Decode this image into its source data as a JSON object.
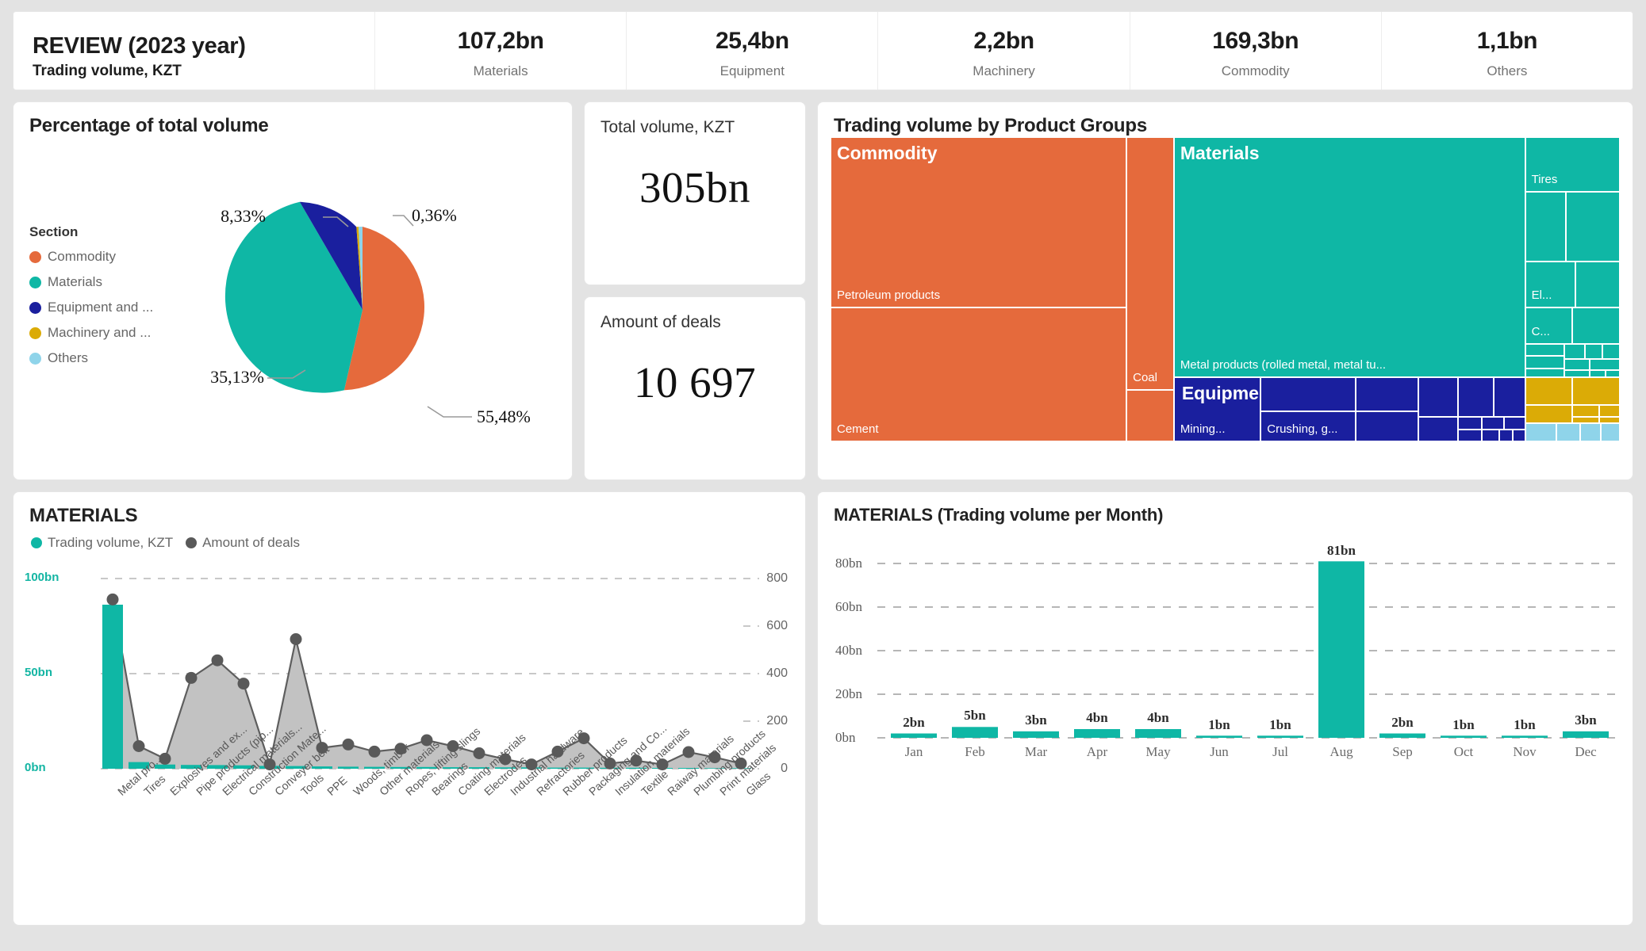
{
  "header": {
    "title": "REVIEW (2023 year)",
    "subtitle": "Trading volume, KZT",
    "kpis": [
      {
        "value": "107,2bn",
        "label": "Materials"
      },
      {
        "value": "25,4bn",
        "label": "Equipment"
      },
      {
        "value": "2,2bn",
        "label": "Machinery"
      },
      {
        "value": "169,3bn",
        "label": "Commodity"
      },
      {
        "value": "1,1bn",
        "label": "Others"
      }
    ]
  },
  "colors": {
    "commodity": "#e56a3c",
    "materials": "#0fb7a5",
    "equipment": "#1a1f9e",
    "machinery": "#dbab06",
    "others": "#8fd4ea",
    "teal_accent": "#14b5a3",
    "gray_series": "#bfbfbf",
    "gray_marker": "#595959",
    "page_bg": "#e3e3e3",
    "card_bg": "#ffffff"
  },
  "pie_card": {
    "title": "Percentage of total volume",
    "legend_heading": "Section",
    "legend": [
      {
        "label": "Commodity",
        "color": "#e56a3c"
      },
      {
        "label": "Materials",
        "color": "#0fb7a5"
      },
      {
        "label": "Equipment and ...",
        "color": "#1a1f9e"
      },
      {
        "label": "Machinery and ...",
        "color": "#dbab06"
      },
      {
        "label": "Others",
        "color": "#8fd4ea"
      }
    ]
  },
  "total_volume_card": {
    "label": "Total volume, KZT",
    "value": "305bn"
  },
  "deals_card": {
    "label": "Amount of deals",
    "value": "10 697"
  },
  "treemap_card": {
    "title": "Trading volume by Product Groups",
    "group_labels": [
      "Commodity",
      "Materials",
      "Equipment and Spare parts"
    ],
    "tile_labels": [
      "Petroleum products",
      "Cement",
      "Coal",
      "Metal products (rolled metal, metal tu...",
      "Tires",
      "El...",
      "C...",
      "Mining...",
      "Crushing, g..."
    ]
  },
  "combo_card": {
    "title": "MATERIALS",
    "legend": [
      {
        "label": "Trading volume, KZT",
        "color": "#0fb7a5"
      },
      {
        "label": "Amount of deals",
        "color": "#595959"
      }
    ]
  },
  "month_card": {
    "title": "MATERIALS (Trading volume per Month)"
  },
  "chart_data": [
    {
      "type": "pie",
      "title": "Percentage of total volume",
      "legend_position": "left",
      "categories": [
        "Commodity",
        "Materials",
        "Equipment and ...",
        "Machinery and ...",
        "Others"
      ],
      "values": [
        55.48,
        35.13,
        8.33,
        0.36,
        0.7
      ],
      "labels": [
        "55,48%",
        "35,13%",
        "8,33%",
        "0,36%",
        ""
      ],
      "colors": [
        "#e56a3c",
        "#0fb7a5",
        "#1a1f9e",
        "#dbab06",
        "#8fd4ea"
      ],
      "unit": "%"
    },
    {
      "type": "treemap",
      "title": "Trading volume by Product Groups",
      "groups": [
        {
          "name": "Commodity",
          "color": "#e56a3c",
          "children": [
            {
              "name": "Petroleum products",
              "value": 96
            },
            {
              "name": "Cement",
              "value": 52
            },
            {
              "name": "Coal",
              "value": 21
            }
          ]
        },
        {
          "name": "Materials",
          "color": "#0fb7a5",
          "children": [
            {
              "name": "Metal products (rolled metal, metal tu...",
              "value": 78
            },
            {
              "name": "Tires",
              "value": 7
            },
            {
              "name": "El...",
              "value": 5
            },
            {
              "name": "C...",
              "value": 4
            }
          ]
        },
        {
          "name": "Equipment and Spare parts",
          "color": "#1a1f9e",
          "children": [
            {
              "name": "Mining...",
              "value": 9
            },
            {
              "name": "Crushing, g...",
              "value": 8
            }
          ]
        },
        {
          "name": "Machinery and ...",
          "color": "#dbab06",
          "children": []
        },
        {
          "name": "Others",
          "color": "#8fd4ea",
          "children": []
        }
      ]
    },
    {
      "type": "bar",
      "title": "MATERIALS",
      "subtype": "combo",
      "legend": [
        "Trading volume, KZT",
        "Amount of deals"
      ],
      "categories": [
        "Metal pro...",
        "Tires",
        "Explosives and ex...",
        "Pipe products (pip...",
        "Electrical materials...",
        "Construction Mate...",
        "Conveyer belt",
        "Tools",
        "PPE",
        "Woods, timber",
        "Other materials",
        "Ropes, lifting slings",
        "Bearings",
        "Coating materials",
        "Electrodes",
        "Industrial hardware",
        "Refractories",
        "Rubber products",
        "Packaging and Co...",
        "Insulation materials",
        "Textile",
        "Raiway materials",
        "Plumbing products",
        "Print materials",
        "Glass"
      ],
      "series": [
        {
          "name": "Trading volume, KZT",
          "type": "bar",
          "axis": "left",
          "unit": "bn",
          "color": "#0fb7a5",
          "values": [
            86,
            3.5,
            2.2,
            2.0,
            1.9,
            1.8,
            1.5,
            1.4,
            1.2,
            1.1,
            1.0,
            0.9,
            0.9,
            0.8,
            0.8,
            0.7,
            0.7,
            0.6,
            0.6,
            0.5,
            0.5,
            0.4,
            0.4,
            0.3,
            0.3
          ]
        },
        {
          "name": "Amount of deals",
          "type": "line-area",
          "axis": "right",
          "color": "#595959",
          "values": [
            712,
            95,
            42,
            382,
            456,
            358,
            18,
            545,
            88,
            102,
            72,
            84,
            120,
            95,
            68,
            40,
            18,
            72,
            128,
            38,
            32,
            18,
            70,
            48,
            22
          ]
        }
      ],
      "left_axis": {
        "ticks": [
          "0bn",
          "50bn",
          "100bn"
        ],
        "min": 0,
        "max": 100
      },
      "right_axis": {
        "ticks": [
          "0",
          "200",
          "400",
          "600",
          "800"
        ],
        "min": 0,
        "max": 800
      },
      "grid": true
    },
    {
      "type": "bar",
      "title": "MATERIALS (Trading volume per Month)",
      "categories": [
        "Jan",
        "Feb",
        "Mar",
        "Apr",
        "May",
        "Jun",
        "Jul",
        "Aug",
        "Sep",
        "Oct",
        "Nov",
        "Dec"
      ],
      "values": [
        2,
        5,
        3,
        4,
        4,
        1,
        1,
        81,
        2,
        1,
        1,
        3
      ],
      "data_labels": [
        "2bn",
        "5bn",
        "3bn",
        "4bn",
        "4bn",
        "1bn",
        "1bn",
        "81bn",
        "2bn",
        "1bn",
        "1bn",
        "3bn"
      ],
      "ylabel": "",
      "xlabel": "",
      "ytick_labels": [
        "0bn",
        "20bn",
        "40bn",
        "60bn",
        "80bn"
      ],
      "ylim": [
        0,
        88
      ],
      "color": "#0fb7a5",
      "grid": true
    }
  ]
}
